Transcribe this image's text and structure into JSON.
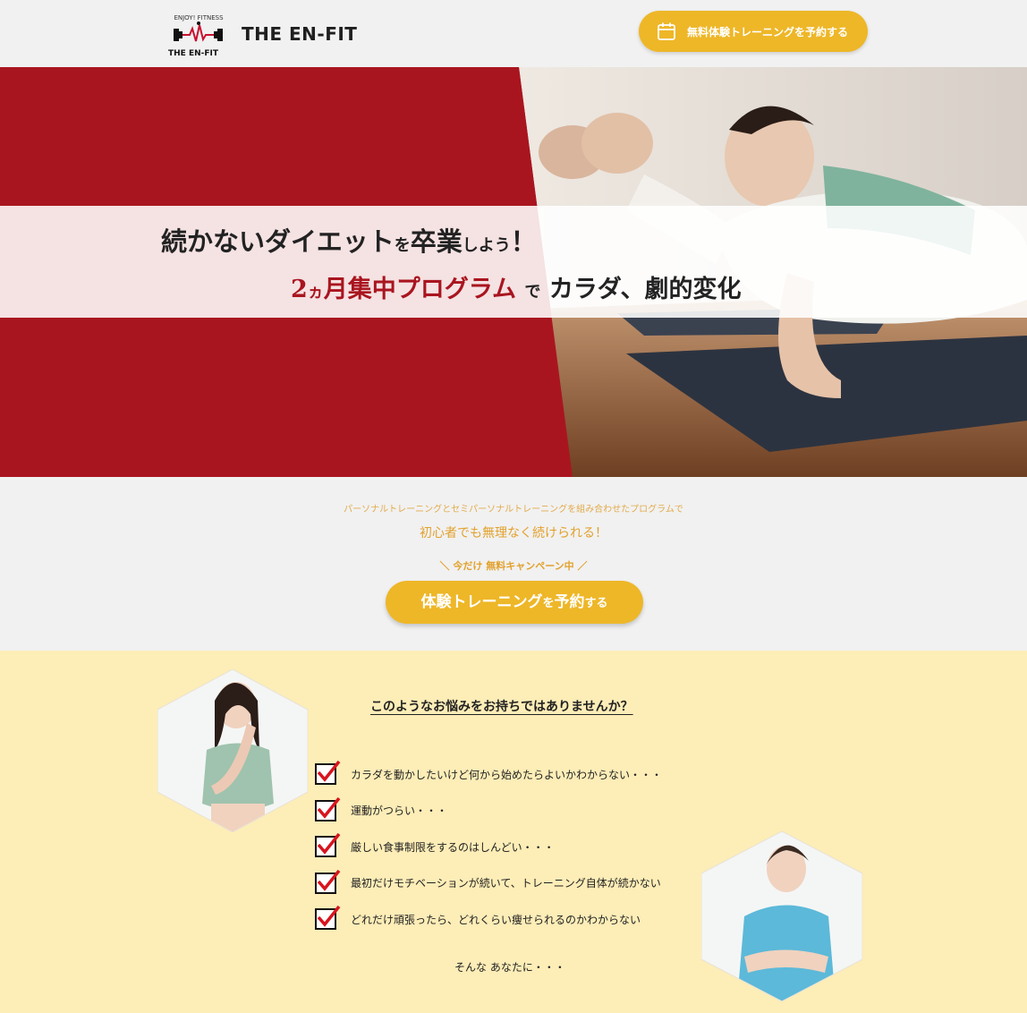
{
  "header": {
    "logo_title": "THE EN-FIT",
    "logo_badge_top": "ENJOY! FITNESS",
    "logo_badge_bottom": "THE EN-FIT",
    "cta_label": "無料体験トレーニングを予約する",
    "cta_icon": "calendar-icon"
  },
  "hero": {
    "line1_a": "続かないダイエット",
    "line1_b": "を",
    "line1_c": "卒業",
    "line1_d": "しよう",
    "line1_e": "！",
    "line2_a": "2",
    "line2_b": "ヵ",
    "line2_c": "月集中プログラム",
    "line2_d": "で",
    "line2_e": "カラダ、劇的変化"
  },
  "intro": {
    "small_text": "パーソナルトレーニングとセミパーソナルトレーニングを組み合わせたプログラムで",
    "big_text": "初心者でも無理なく続けられる！",
    "campaign_left": "＼",
    "campaign_text": "今だけ 無料キャンペーン中",
    "campaign_right": "／",
    "cta_a": "体験トレーニング",
    "cta_b": "を",
    "cta_c": "予約",
    "cta_d": "する"
  },
  "worries": {
    "title": "このようなお悩みをお持ちではありませんか？",
    "items": [
      "カラダを動かしたいけど何から始めたらよいかわからない・・・",
      "運動がつらい・・・",
      "厳しい食事制限をするのはしんどい・・・",
      "最初だけモチベーションが続いて、トレーニング自体が続かない",
      "どれだけ頑張ったら、どれくらい痩せられるのかわからない"
    ],
    "closing": "そんな あなたに・・・"
  },
  "colors": {
    "brand_red": "#a9151f",
    "accent_yellow": "#eeb728",
    "worry_bg": "#fdedb7",
    "page_bg": "#f1f1f1"
  }
}
